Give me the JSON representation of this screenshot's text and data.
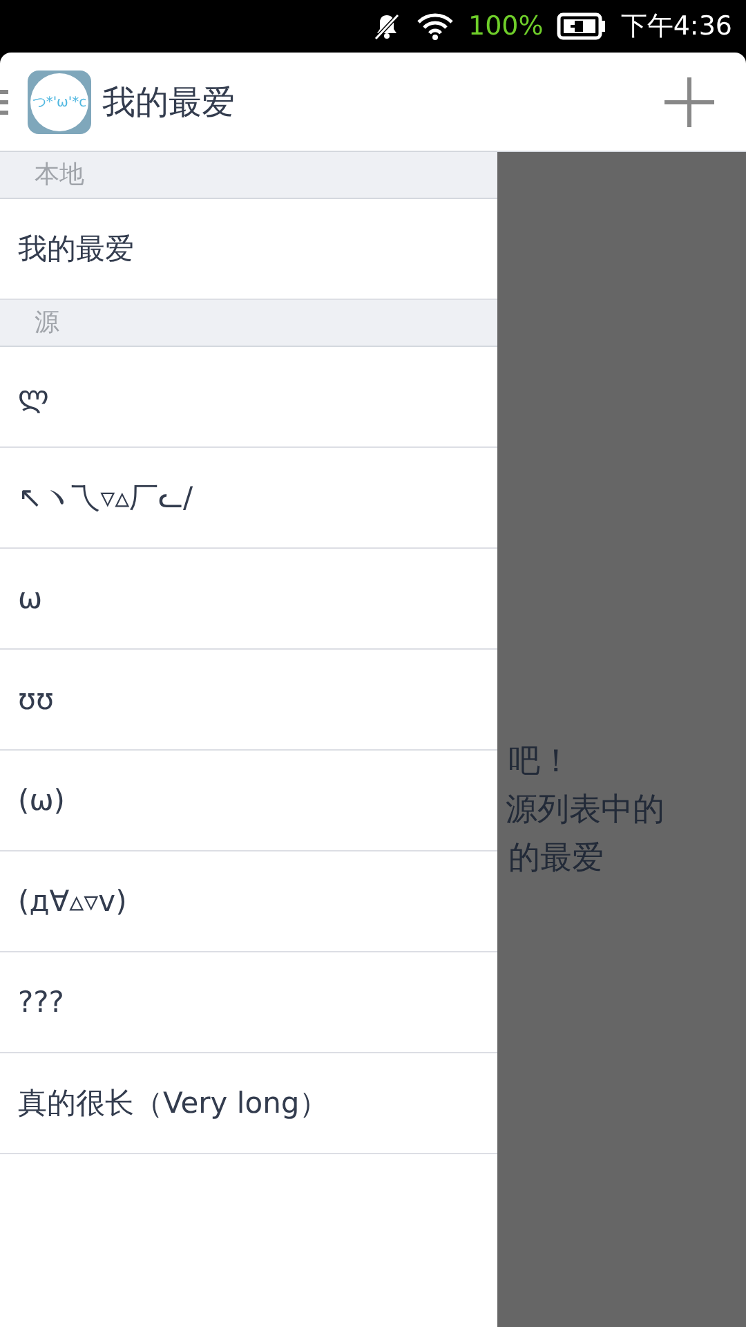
{
  "status_bar": {
    "battery": "100%",
    "time": "下午4:36"
  },
  "app_bar": {
    "logo_text": "つ*'ω'*c",
    "title": "我的最爱"
  },
  "drawer": {
    "sections": [
      {
        "header": "本地",
        "items": [
          {
            "label": "我的最爱"
          }
        ]
      },
      {
        "header": "源",
        "items": [
          {
            "label": "ლ"
          },
          {
            "label": "↖ヽ乁▿▵厂ᓚ/"
          },
          {
            "label": "ω"
          },
          {
            "label": "ʊʊ"
          },
          {
            "label": "(ω)"
          },
          {
            "label": "(д∀▵▿v)"
          },
          {
            "label": "???"
          },
          {
            "label": "真的很长（Very long）"
          }
        ]
      }
    ]
  },
  "background_text": [
    "吧！",
    "源列表中的",
    "的最爱"
  ]
}
